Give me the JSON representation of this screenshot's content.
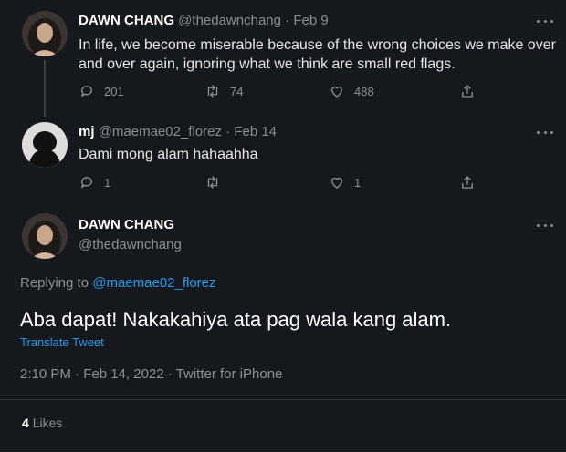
{
  "tweet1": {
    "display_name": "DAWN CHANG",
    "handle": "@thedawnchang",
    "separator": "·",
    "date": "Feb 9",
    "text_line1": "In life, we become miserable because of the wrong choices we make over",
    "text_line2": "and over again, ignoring what we think are small red flags.",
    "replies": "201",
    "retweets": "74",
    "likes": "488"
  },
  "tweet2": {
    "display_name": "mj",
    "handle": "@maemae02_florez",
    "separator": "·",
    "date": "Feb 14",
    "text": "Dami mong alam hahaahha",
    "replies": "1",
    "retweets": "",
    "likes": "1"
  },
  "main_tweet": {
    "display_name": "DAWN CHANG",
    "handle": "@thedawnchang",
    "replying_prefix": "Replying to",
    "replying_handle": "@maemae02_florez",
    "text": "Aba dapat! Nakakahiya ata pag wala kang alam.",
    "translate_label": "Translate Tweet",
    "timestamp": "2:10 PM · Feb 14, 2022 · Twitter for iPhone",
    "likes_count": "4",
    "likes_label": "Likes"
  },
  "icons": {
    "reply": "reply-icon",
    "retweet": "retweet-icon",
    "like": "heart-icon",
    "share": "share-icon",
    "more": "more-icon"
  },
  "colors": {
    "background": "#15181c",
    "link": "#1d9bf0",
    "muted": "#8b9096"
  }
}
